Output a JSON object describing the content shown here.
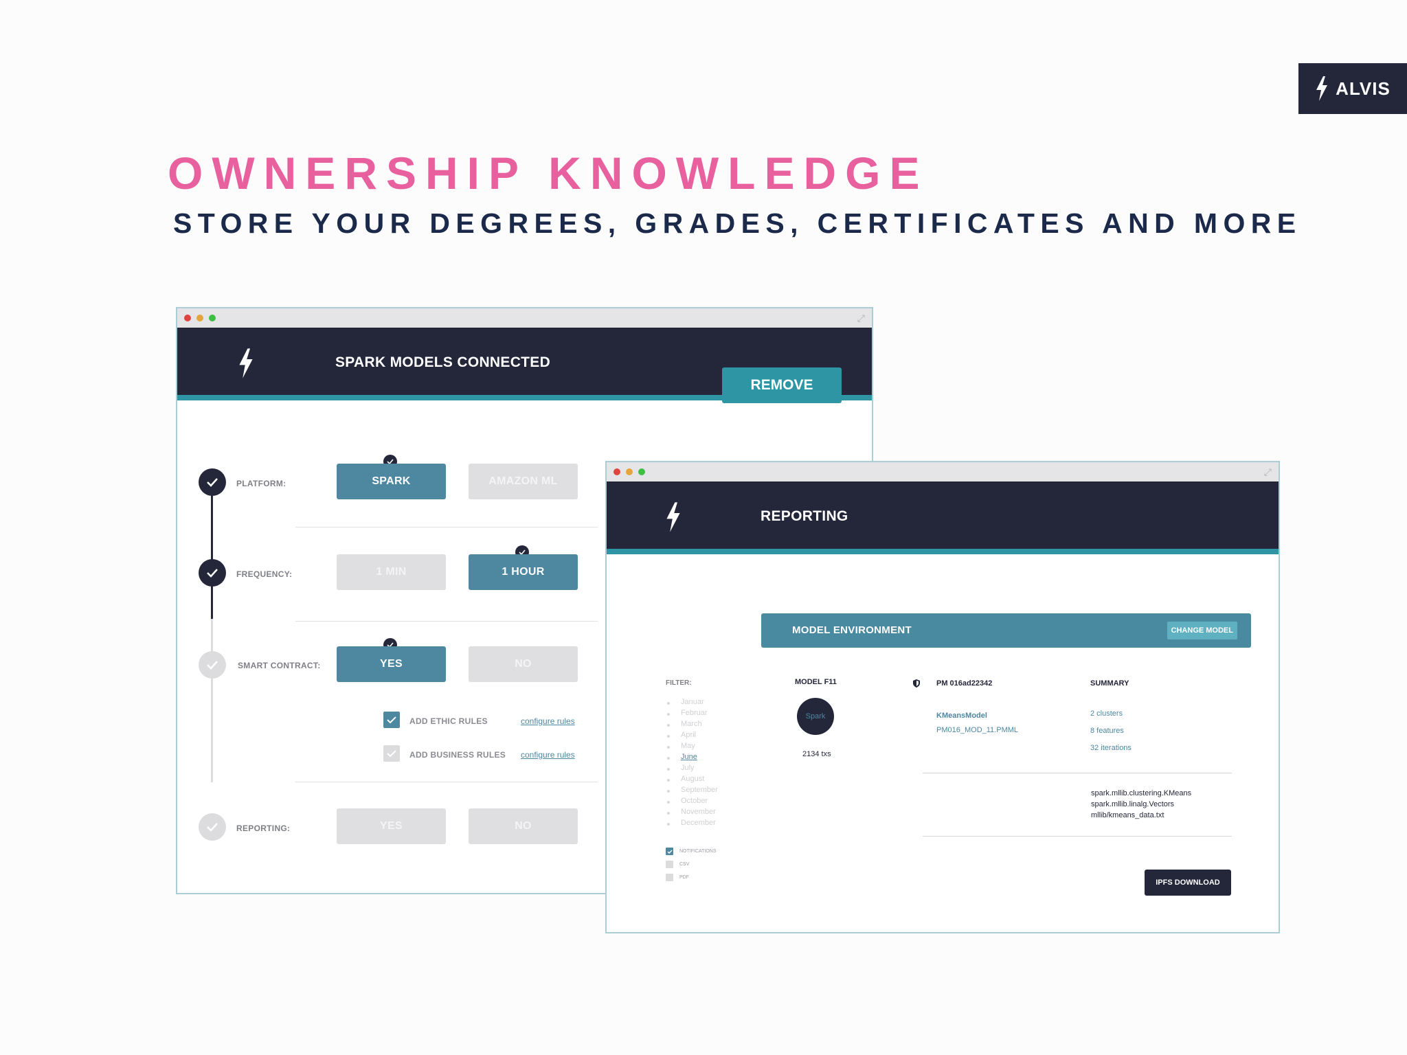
{
  "brand": {
    "name": "ALVIS"
  },
  "headline": "OWNERSHIP KNOWLEDGE",
  "subheadline": "STORE YOUR DEGREES, GRADES, CERTIFICATES AND MORE",
  "colors": {
    "accent_pink": "#e9609f",
    "navy": "#24263a",
    "teal": "#2e95a5",
    "steel_blue": "#4d87a0"
  },
  "window1": {
    "title": "SPARK MODELS CONNECTED",
    "remove_label": "REMOVE",
    "steps": [
      {
        "label": "PLATFORM:",
        "options": [
          "SPARK",
          "AMAZON ML"
        ],
        "selected": "SPARK",
        "done": true
      },
      {
        "label": "FREQUENCY:",
        "options": [
          "1 MIN",
          "1 HOUR"
        ],
        "selected": "1 HOUR",
        "done": true
      },
      {
        "label": "SMART CONTRACT:",
        "options": [
          "YES",
          "NO"
        ],
        "selected": "YES",
        "done": false
      },
      {
        "label": "REPORTING:",
        "options": [
          "YES",
          "NO"
        ],
        "selected": "",
        "done": false
      }
    ],
    "rules": [
      {
        "label": "ADD ETHIC RULES",
        "checked": true,
        "link": "configure rules"
      },
      {
        "label": "ADD BUSINESS RULES",
        "checked": false,
        "link": "configure rules"
      }
    ]
  },
  "window2": {
    "title": "REPORTING",
    "env_title": "MODEL ENVIRONMENT",
    "change_model_label": "CHANGE MODEL",
    "filter_label": "FILTER:",
    "months": [
      "Januar",
      "Februar",
      "March",
      "April",
      "May",
      "June",
      "July",
      "August",
      "September",
      "October",
      "November",
      "December"
    ],
    "active_month": "June",
    "notify": [
      {
        "label": "NOTIFICATIONS",
        "checked": true
      },
      {
        "label": "CSV",
        "checked": false
      },
      {
        "label": "PDF",
        "checked": false
      }
    ],
    "model_title": "MODEL F11",
    "model_circle": "Spark",
    "model_txs": "2134 txs",
    "pm_title": "PM 016ad22342",
    "pm_model": "KMeansModel",
    "pm_file": "PM016_MOD_11.PMML",
    "summary_title": "SUMMARY",
    "summary_items": [
      "2 clusters",
      "8 features",
      "32 iterations"
    ],
    "imports": [
      "spark.mllib.clustering.KMeans",
      "spark.mllib.linalg.Vectors",
      "mllib/kmeans_data.txt"
    ],
    "download_label": "IPFS DOWNLOAD"
  }
}
